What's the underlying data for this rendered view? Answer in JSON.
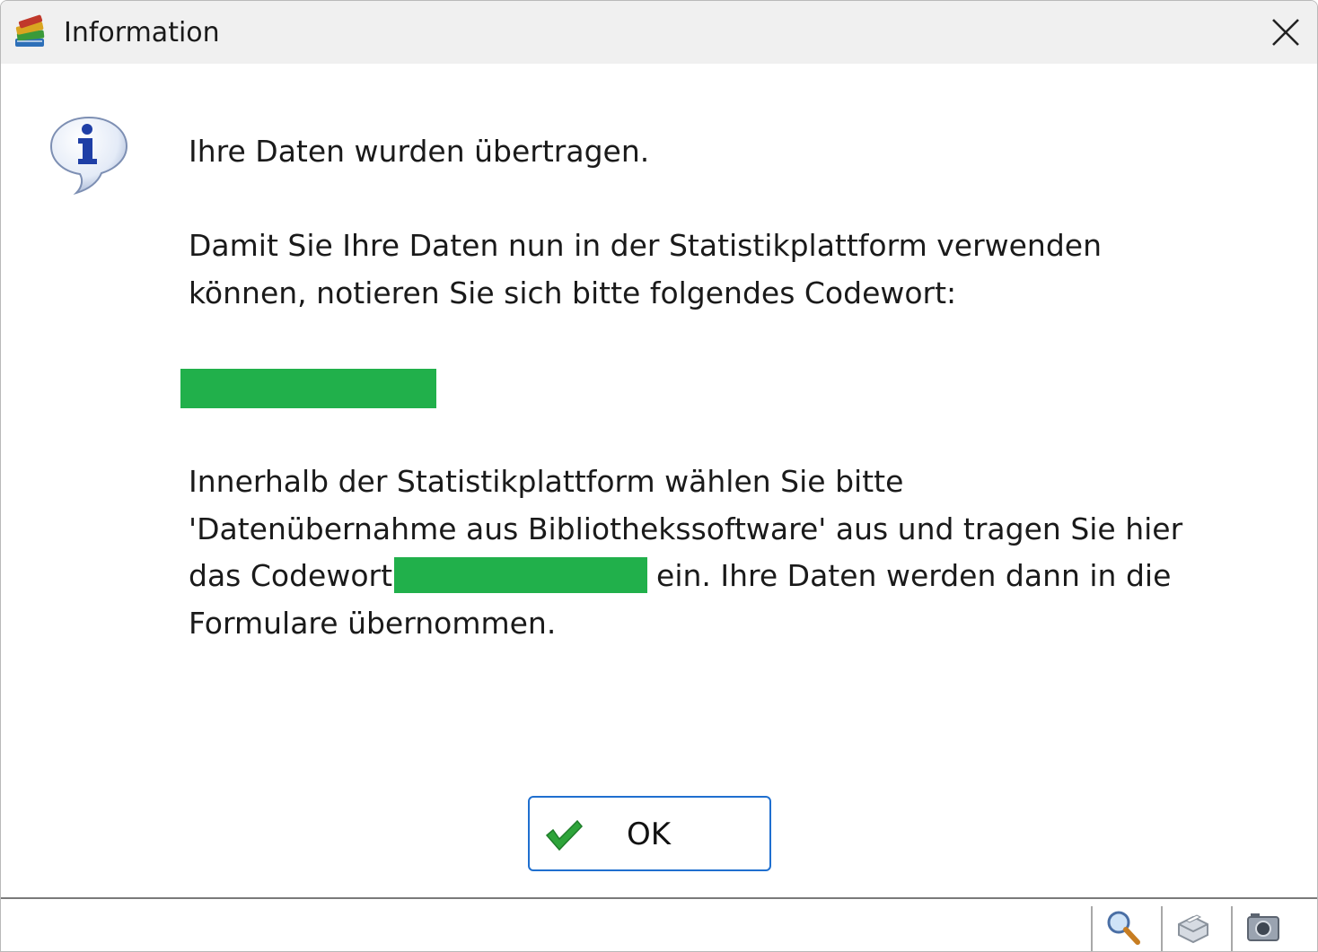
{
  "window": {
    "title": "Information",
    "app_icon": "books-stack-icon",
    "close_icon": "close-icon"
  },
  "message": {
    "icon": "info-speech-bubble-icon",
    "line1": "Ihre Daten wurden übertragen.",
    "para2_line1": "Damit Sie Ihre Daten nun in der Statistikplattform verwenden",
    "para2_line2": "können, notieren Sie sich bitte folgendes Codewort:",
    "codeword_redaction_color": "#21b04b",
    "para3_line1": "Innerhalb der Statistikplattform wählen Sie bitte",
    "para3_line2": "'Datenübernahme aus Bibliothekssoftware' aus und tragen Sie hier",
    "para3_line3_before": "das Codewort",
    "para3_line3_after": "ein. Ihre Daten werden dann in die",
    "para3_line4": "Formulare übernommen."
  },
  "ok_button": {
    "label": "OK",
    "icon": "checkmark-icon",
    "border_color": "#1f6fcf"
  },
  "statusbar": {
    "icons": [
      "magnifier-icon",
      "printer-icon",
      "camera-icon"
    ]
  }
}
